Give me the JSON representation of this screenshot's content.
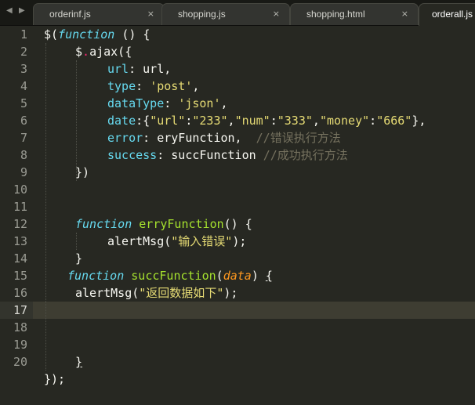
{
  "tabs": [
    {
      "label": "orderinf.js",
      "close": "×"
    },
    {
      "label": "shopping.js",
      "close": "×"
    },
    {
      "label": "shopping.html",
      "close": "×"
    },
    {
      "label": "orderall.js",
      "close": ""
    }
  ],
  "nav": {
    "prev": "◀",
    "next": "▶"
  },
  "line_numbers": [
    "1",
    "2",
    "3",
    "4",
    "5",
    "6",
    "7",
    "8",
    "9",
    "10",
    "11",
    "12",
    "13",
    "14",
    "15",
    "16",
    "17",
    "18",
    "19",
    "20"
  ],
  "current_line": "17",
  "code": {
    "l1": {
      "a": "$(",
      "b": "function",
      "c": " () {"
    },
    "l2": {
      "a": "$",
      "b": ".",
      "c": "ajax({"
    },
    "l3": {
      "a": "url",
      "b": ": url,"
    },
    "l4": {
      "a": "type",
      "b": ": ",
      "c": "'post'",
      "d": ","
    },
    "l5": {
      "a": "dataType",
      "b": ": ",
      "c": "'json'",
      "d": ","
    },
    "l6": {
      "a": "date",
      "b": ":{",
      "c": "\"url\"",
      "d": ":",
      "e": "\"233\"",
      "f": ",",
      "g": "\"num\"",
      "h": ":",
      "i": "\"333\"",
      "j": ",",
      "k": "\"money\"",
      "l": ":",
      "m": "\"666\"",
      "n": "},"
    },
    "l7": {
      "a": "error",
      "b": ": eryFunction,  ",
      "c": "//错误执行方法"
    },
    "l8": {
      "a": "success",
      "b": ": succFunction ",
      "c": "//成功执行方法"
    },
    "l9": {
      "a": "})"
    },
    "l11": {
      "a": "function",
      "b": " ",
      "c": "erryFunction",
      "d": "() {"
    },
    "l12": {
      "a": "alertMsg(",
      "b": "\"输入错误\"",
      "c": ");"
    },
    "l13": {
      "a": "}"
    },
    "l14": {
      "a": "function",
      "b": " ",
      "c": "succFunction",
      "d": "(",
      "e": "data",
      "f": ") ",
      "g": "{"
    },
    "l15": {
      "a": "alertMsg(",
      "b": "\"返回数据如下\"",
      "c": ");"
    },
    "l19": {
      "a": "}"
    },
    "l20": {
      "a": "});"
    }
  },
  "colors": {
    "background": "#272822",
    "keyword": "#66d9ef",
    "function_name": "#a6e22e",
    "string": "#e6db74",
    "operator": "#f92672",
    "comment": "#75715e",
    "parameter": "#fd971f"
  }
}
